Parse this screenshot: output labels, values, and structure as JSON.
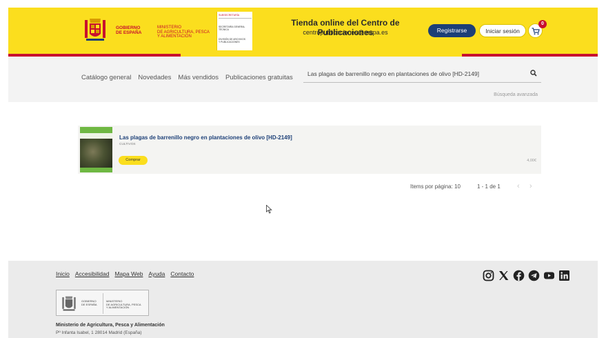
{
  "header": {
    "gov_name": "GOBIERNO\nDE ESPAÑA",
    "ministry_name": "MINISTERIO\nDE AGRICULTURA, PESCA\nY ALIMENTACIÓN",
    "subsec_title": "SUBSECRETARÍA",
    "subsec_line1": "SECRETARÍA GENERAL\nTÉCNICA",
    "subsec_line2": "DIVISIÓN DE ARCHIVOS\nY PUBLICACIONES",
    "site_title": "Tienda online del Centro de Publicaciones",
    "site_email": "centropublicaciones@mapa.es",
    "register_label": "Registrarse",
    "login_label": "Iniciar sesión",
    "cart_count": "0",
    "cart_icon": "cart-icon"
  },
  "nav": {
    "items": [
      {
        "label": "Catálogo general"
      },
      {
        "label": "Novedades"
      },
      {
        "label": "Más vendidos"
      },
      {
        "label": "Publicaciones gratuitas"
      }
    ]
  },
  "search": {
    "value": "Las plagas de barrenillo negro en plantaciones de olivo [HD-2149]",
    "icon": "search-icon",
    "advanced_label": "Búsqueda avanzada"
  },
  "results": [
    {
      "title": "Las plagas de barrenillo negro en plantaciones de olivo [HD-2149]",
      "category": "CULTIVOS",
      "buy_label": "Comprar",
      "price": "4,00€"
    }
  ],
  "pagination": {
    "items_per_page_label": "Items por página: 10",
    "range": "1 - 1 de 1",
    "prev": "‹",
    "next": "›"
  },
  "footer": {
    "links": [
      {
        "label": "Inicio"
      },
      {
        "label": "Accesibilidad"
      },
      {
        "label": "Mapa Web"
      },
      {
        "label": "Ayuda"
      },
      {
        "label": "Contacto"
      }
    ],
    "social_icons": [
      "instagram-icon",
      "x-icon",
      "facebook-icon",
      "telegram-icon",
      "youtube-icon",
      "linkedin-icon"
    ],
    "logo_gov": "GOBIERNO\nDE ESPAÑA",
    "logo_ministry": "MINISTERIO\nDE AGRICULTURA, PESCA\nY ALIMENTACIÓN",
    "org_name": "Ministerio de Agricultura, Pesca y Alimentación",
    "address": "Pº Infanta Isabel, 1 28014 Madrid (España)"
  },
  "colors": {
    "header_yellow": "#fbde1e",
    "brand_red": "#c8102e",
    "brand_navy": "#1c3f77"
  }
}
